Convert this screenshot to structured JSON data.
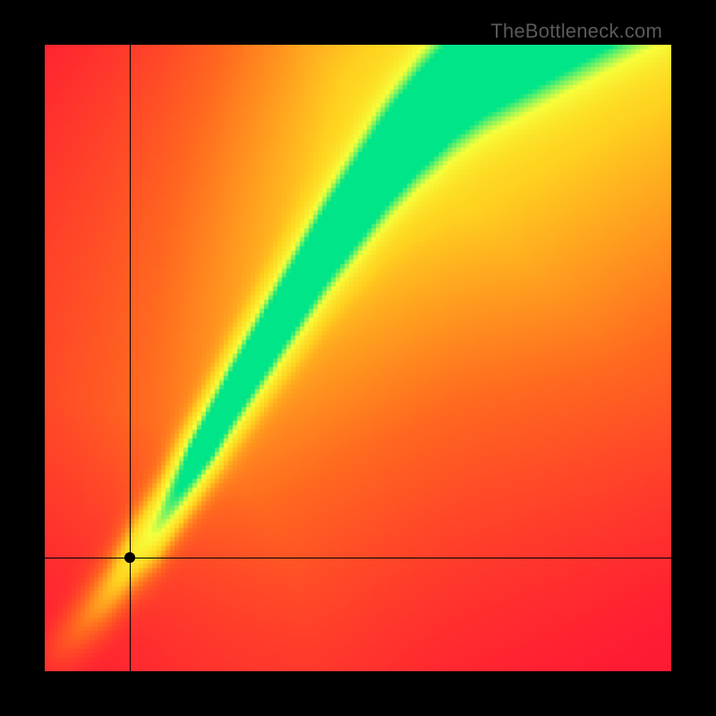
{
  "watermark": "TheBottleneck.com",
  "crosshair": {
    "x_frac": 0.136,
    "y_frac": 0.818
  },
  "chart_data": {
    "type": "heatmap",
    "title": "",
    "xlabel": "",
    "ylabel": "",
    "xlim": [
      0,
      1
    ],
    "ylim": [
      0,
      1
    ],
    "note": "Color encodes a compatibility score. Green = optimal along a ridge curve; red = worst; yellow/orange = intermediate. Axes are normalized component performance.",
    "colorscale": [
      {
        "stop": 0.0,
        "color": "#ff1a33"
      },
      {
        "stop": 0.25,
        "color": "#ff6a1f"
      },
      {
        "stop": 0.5,
        "color": "#ffd21f"
      },
      {
        "stop": 0.75,
        "color": "#f7ff3a"
      },
      {
        "stop": 1.0,
        "color": "#00e588"
      }
    ],
    "ridge_curve": [
      {
        "x": 0.0,
        "y": 0.0
      },
      {
        "x": 0.05,
        "y": 0.06
      },
      {
        "x": 0.1,
        "y": 0.12
      },
      {
        "x": 0.14,
        "y": 0.18
      },
      {
        "x": 0.18,
        "y": 0.23
      },
      {
        "x": 0.22,
        "y": 0.3
      },
      {
        "x": 0.26,
        "y": 0.37
      },
      {
        "x": 0.3,
        "y": 0.44
      },
      {
        "x": 0.35,
        "y": 0.52
      },
      {
        "x": 0.4,
        "y": 0.6
      },
      {
        "x": 0.45,
        "y": 0.68
      },
      {
        "x": 0.5,
        "y": 0.75
      },
      {
        "x": 0.55,
        "y": 0.82
      },
      {
        "x": 0.6,
        "y": 0.88
      },
      {
        "x": 0.65,
        "y": 0.93
      },
      {
        "x": 0.7,
        "y": 0.97
      },
      {
        "x": 0.75,
        "y": 1.0
      }
    ],
    "marker": {
      "x": 0.136,
      "y": 0.182
    }
  }
}
